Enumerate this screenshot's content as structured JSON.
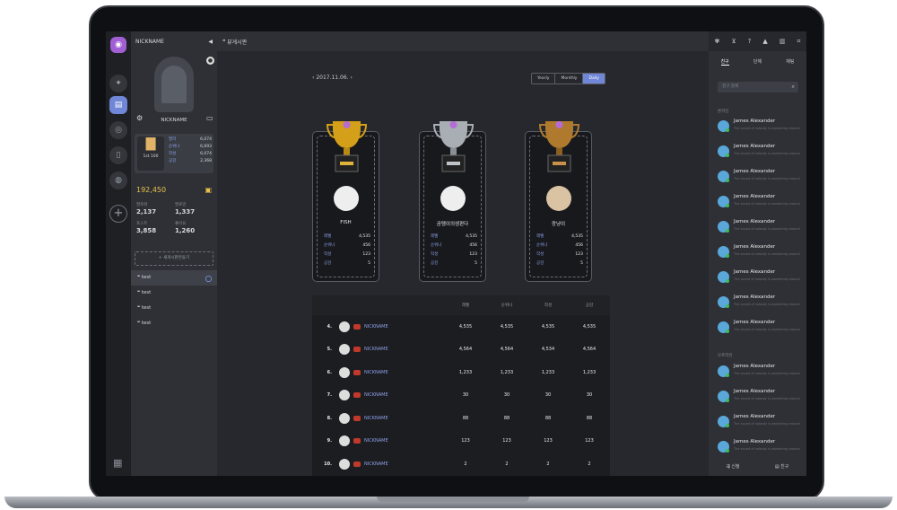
{
  "header": {
    "nickname": "NICKNAME",
    "board_title": "뷰게시판"
  },
  "profile": {
    "nickname": "NICKNAME",
    "grade_label": "1st 100",
    "stats": [
      {
        "k": "팔러",
        "v": "6,074"
      },
      {
        "k": "순위나",
        "v": "6,693"
      },
      {
        "k": "작성",
        "v": "6,074"
      },
      {
        "k": "공감",
        "v": "2,368"
      }
    ],
    "gold": "192,450",
    "counts": [
      {
        "k": "팔로워",
        "v": "2,137"
      },
      {
        "k": "팔로잉",
        "v": "1,337"
      },
      {
        "k": "포스트",
        "v": "3,858"
      },
      {
        "k": "좋아요",
        "v": "1,260"
      }
    ],
    "new_button": "+ 새게시판만들기"
  },
  "boards": [
    "test",
    "test",
    "test",
    "test"
  ],
  "search": {
    "placeholder": "게시판 검색"
  },
  "ranking": {
    "date": "2017.11.06.",
    "periods": [
      "Yearly",
      "Monthly",
      "Daily"
    ],
    "active_period": "Daily",
    "cards": [
      {
        "rank": "1",
        "name": "FISH",
        "stats": [
          {
            "k": "레벨",
            "v": "4,535"
          },
          {
            "k": "순위나",
            "v": "456"
          },
          {
            "k": "작성",
            "v": "123"
          },
          {
            "k": "공감",
            "v": "5"
          }
        ]
      },
      {
        "rank": "2",
        "name": "곰탱이의생판다",
        "stats": [
          {
            "k": "레벨",
            "v": "4,535"
          },
          {
            "k": "순위나",
            "v": "456"
          },
          {
            "k": "작성",
            "v": "123"
          },
          {
            "k": "공감",
            "v": "5"
          }
        ]
      },
      {
        "rank": "3",
        "name": "깡냥이",
        "stats": [
          {
            "k": "레벨",
            "v": "4,535"
          },
          {
            "k": "순위나",
            "v": "456"
          },
          {
            "k": "작성",
            "v": "123"
          },
          {
            "k": "공감",
            "v": "5"
          }
        ]
      }
    ],
    "columns": [
      "레벨",
      "순위나",
      "작성",
      "공감"
    ],
    "rows": [
      {
        "rank": "4.",
        "name": "NICKNAME",
        "vals": [
          "4,535",
          "4,535",
          "4,535",
          "4,535"
        ]
      },
      {
        "rank": "5.",
        "name": "NICKNAME",
        "vals": [
          "4,564",
          "4,564",
          "4,534",
          "4,564"
        ]
      },
      {
        "rank": "6.",
        "name": "NICKNAME",
        "vals": [
          "1,233",
          "1,233",
          "1,233",
          "1,233"
        ]
      },
      {
        "rank": "7.",
        "name": "NICKNAME",
        "vals": [
          "30",
          "30",
          "30",
          "30"
        ]
      },
      {
        "rank": "8.",
        "name": "NICKNAME",
        "vals": [
          "88",
          "88",
          "88",
          "88"
        ]
      },
      {
        "rank": "9.",
        "name": "NICKNAME",
        "vals": [
          "123",
          "123",
          "123",
          "123"
        ]
      },
      {
        "rank": "10.",
        "name": "NICKNAME",
        "vals": [
          "2",
          "2",
          "2",
          "2"
        ]
      }
    ]
  },
  "right": {
    "tabs": [
      "친구",
      "단체",
      "채팅"
    ],
    "search_placeholder": "친구 검색",
    "section_online": "온라인",
    "section_offline": "오프라인",
    "friend_name": "James Alexander",
    "friend_status": "The sound of nobody is wandering around",
    "bottom": [
      "신청",
      "친구"
    ]
  }
}
